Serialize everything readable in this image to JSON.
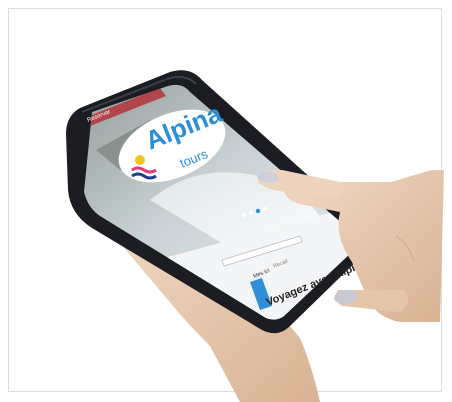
{
  "logo": {
    "word": "Alpina",
    "sub": "tours",
    "colors": {
      "primary": "#2a8fd6",
      "pink": "#e23a7a",
      "yellow": "#f2c31c",
      "navy": "#1e3f8a"
    }
  },
  "screen": {
    "top_label": "Reservar",
    "search_label": "Mes ici",
    "search_placeholder": "Recall",
    "tagline": "Voyagez avec Alpina",
    "dots_count": 4,
    "active_dot": 2
  },
  "colors": {
    "phone_body": "#1b1d22",
    "phone_frame": "#2d3038",
    "screen_sky": "#cfd8dc",
    "snow": "#eef2f5",
    "accent_blue": "#2f8fd8",
    "skin": "#e8c9ae",
    "nail": "#c8c9d4"
  }
}
